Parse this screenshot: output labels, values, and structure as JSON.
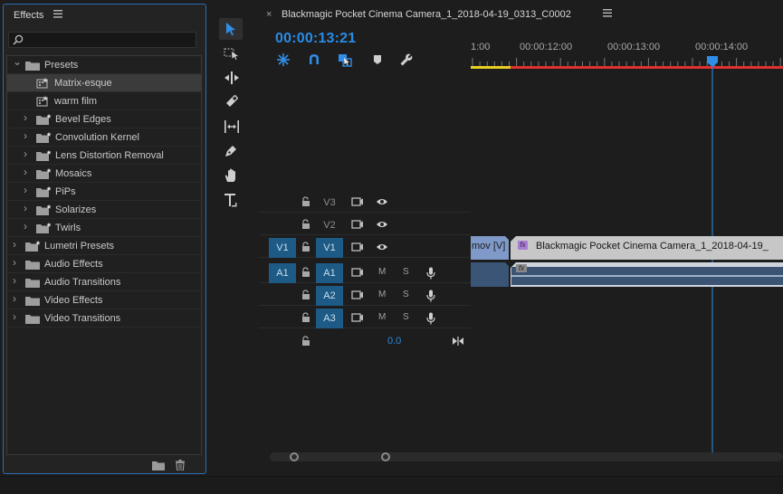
{
  "effects_panel": {
    "title": "Effects",
    "menu_icon": "hamburger-icon",
    "search": {
      "placeholder": "",
      "value": ""
    },
    "tree": [
      {
        "label": "Presets",
        "expanded": true,
        "level": 0,
        "type": "folder"
      },
      {
        "label": "Matrix-esque",
        "level": 1,
        "type": "preset",
        "selected": true
      },
      {
        "label": "warm film",
        "level": 1,
        "type": "preset"
      },
      {
        "label": "Bevel Edges",
        "level": 1,
        "type": "folder-star"
      },
      {
        "label": "Convolution Kernel",
        "level": 1,
        "type": "folder-star"
      },
      {
        "label": "Lens Distortion Removal",
        "level": 1,
        "type": "folder-star"
      },
      {
        "label": "Mosaics",
        "level": 1,
        "type": "folder-star"
      },
      {
        "label": "PiPs",
        "level": 1,
        "type": "folder-star"
      },
      {
        "label": "Solarizes",
        "level": 1,
        "type": "folder-star"
      },
      {
        "label": "Twirls",
        "level": 1,
        "type": "folder-star"
      },
      {
        "label": "Lumetri Presets",
        "level": 0,
        "type": "folder-star"
      },
      {
        "label": "Audio Effects",
        "level": 0,
        "type": "folder"
      },
      {
        "label": "Audio Transitions",
        "level": 0,
        "type": "folder"
      },
      {
        "label": "Video Effects",
        "level": 0,
        "type": "folder"
      },
      {
        "label": "Video Transitions",
        "level": 0,
        "type": "folder"
      }
    ]
  },
  "tools": [
    "selection-tool-icon",
    "track-select-tool-icon",
    "ripple-edit-tool-icon",
    "razor-tool-icon",
    "slip-tool-icon",
    "pen-tool-icon",
    "hand-tool-icon",
    "type-tool-icon"
  ],
  "timeline": {
    "close": "×",
    "title": "Blackmagic Pocket Cinema Camera_1_2018-04-19_0313_C0002",
    "menu_icon": "hamburger-icon",
    "timecode": "00:00:13:21",
    "ruler_labels": [
      "1:00",
      "00:00:12:00",
      "00:00:13:00",
      "00:00:14:00"
    ],
    "tracks": {
      "v3": {
        "label": "V3"
      },
      "v2": {
        "label": "V2"
      },
      "v1": {
        "source": "V1",
        "label": "V1"
      },
      "a1": {
        "source": "A1",
        "label": "A1",
        "m": "M",
        "s": "S"
      },
      "a2": {
        "label": "A2",
        "m": "M",
        "s": "S"
      },
      "a3": {
        "label": "A3",
        "m": "M",
        "s": "S"
      },
      "master": {
        "value": "0.0"
      }
    },
    "clips": {
      "v1_prev": "mov [V]",
      "v1_main": "Blackmagic Pocket Cinema Camera_1_2018-04-19_",
      "fx": "fx"
    },
    "colors": {
      "accent": "#2a8be6",
      "playhead": "#2a8be6",
      "work_area_red": "#e03030",
      "work_area_yellow": "#e8d020",
      "clip_video": "#a9b0c9",
      "clip_audio": "#3b5473"
    }
  }
}
